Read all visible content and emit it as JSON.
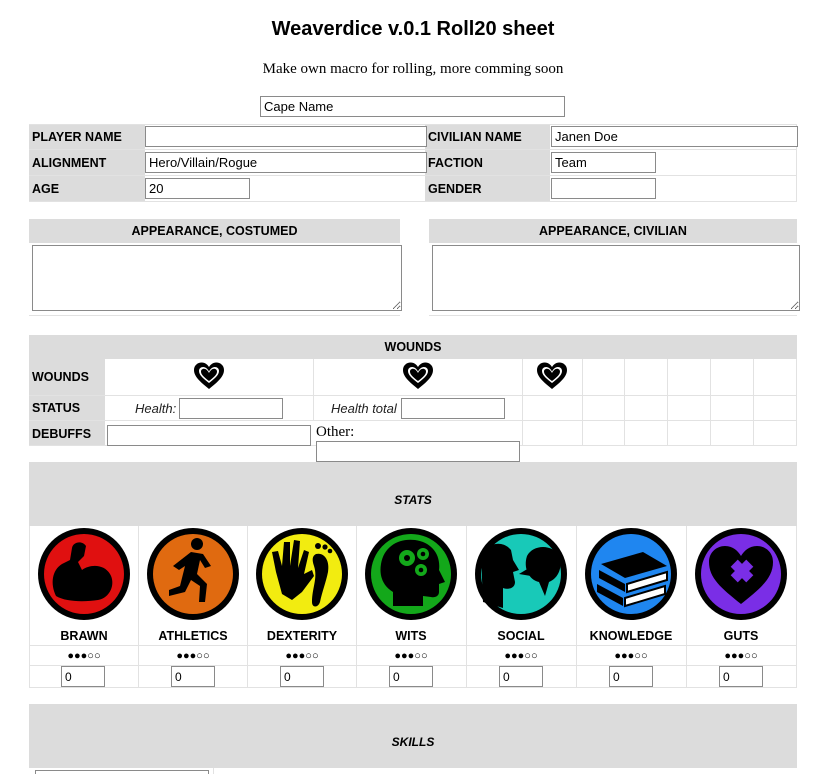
{
  "page": {
    "title": "Weaverdice v.0.1 Roll20 sheet",
    "subtitle": "Make own macro for rolling, more comming soon"
  },
  "cape_name": {
    "value": "Cape Name"
  },
  "identity": {
    "player_name_label": "PLAYER NAME",
    "player_name_value": "",
    "civilian_name_label": "CIVILIAN NAME",
    "civilian_name_value": "Janen Doe",
    "alignment_label": "ALIGNMENT",
    "alignment_value": "Hero/Villain/Rogue",
    "faction_label": "FACTION",
    "faction_value": "Team",
    "age_label": "AGE",
    "age_value": "20",
    "gender_label": "GENDER",
    "gender_value": ""
  },
  "appearance": {
    "costumed_label": "APPEARANCE, COSTUMED",
    "civilian_label": "APPEARANCE, CIVILIAN"
  },
  "wounds": {
    "header": "WOUNDS",
    "row_label": "WOUNDS",
    "status_label": "STATUS",
    "health_label": "Health:",
    "health_value": "",
    "health_total_label": "Health total",
    "health_total_value": "",
    "debuffs_label": "DEBUFFS",
    "debuffs_value": "",
    "other_label": "Other:",
    "other_value": "",
    "heart_icon": "heart-outline-icon"
  },
  "stats": {
    "header": "STATS",
    "items": [
      {
        "name": "BRAWN",
        "dots": "●●●○○",
        "value": "0",
        "icon": "flexing-arm-icon",
        "color": "#e01010"
      },
      {
        "name": "ATHLETICS",
        "dots": "●●●○○",
        "value": "0",
        "icon": "runner-icon",
        "color": "#e06a10"
      },
      {
        "name": "DEXTERITY",
        "dots": "●●●○○",
        "value": "0",
        "icon": "hand-and-foot-icon",
        "color": "#f2ec10"
      },
      {
        "name": "WITS",
        "dots": "●●●○○",
        "value": "0",
        "icon": "head-gears-icon",
        "color": "#13a81a"
      },
      {
        "name": "SOCIAL",
        "dots": "●●●○○",
        "value": "0",
        "icon": "talking-heads-icon",
        "color": "#18c9b8"
      },
      {
        "name": "KNOWLEDGE",
        "dots": "●●●○○",
        "value": "0",
        "icon": "books-icon",
        "color": "#1f86f0"
      },
      {
        "name": "GUTS",
        "dots": "●●●○○",
        "value": "0",
        "icon": "heart-bandage-icon",
        "color": "#7a2ee6"
      }
    ]
  },
  "skills": {
    "header": "SKILLS"
  }
}
